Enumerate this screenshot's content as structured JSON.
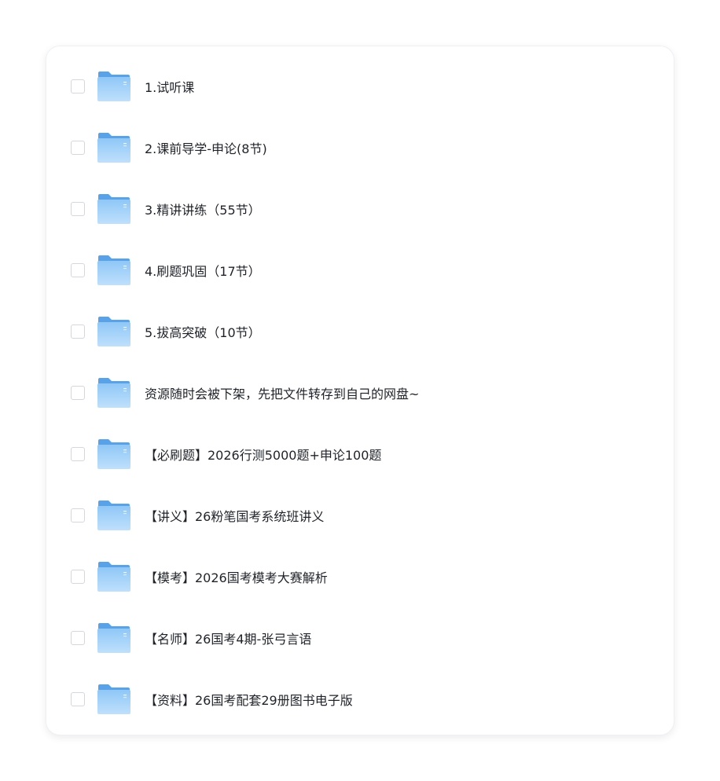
{
  "folders": [
    {
      "label": "1.试听课"
    },
    {
      "label": "2.课前导学-申论(8节)"
    },
    {
      "label": "3.精讲讲练（55节）"
    },
    {
      "label": "4.刷题巩固（17节）"
    },
    {
      "label": "5.拔高突破（10节）"
    },
    {
      "label": "资源随时会被下架，先把文件转存到自己的网盘~"
    },
    {
      "label": "【必刷题】2026行测5000题+申论100题"
    },
    {
      "label": "【讲义】26粉笔国考系统班讲义"
    },
    {
      "label": "【模考】2026国考模考大赛解析"
    },
    {
      "label": "【名师】26国考4期-张弓言语"
    },
    {
      "label": "【资料】26国考配套29册图书电子版"
    }
  ],
  "icons": {
    "folder": "folder-icon",
    "checkbox": "checkbox"
  },
  "colors": {
    "folder_back": "#5aa2e8",
    "folder_front_top": "#8fc7f7",
    "folder_front_bottom": "#bfe0fc",
    "checkbox_border": "#d4d7dd",
    "text": "#1f2329"
  }
}
